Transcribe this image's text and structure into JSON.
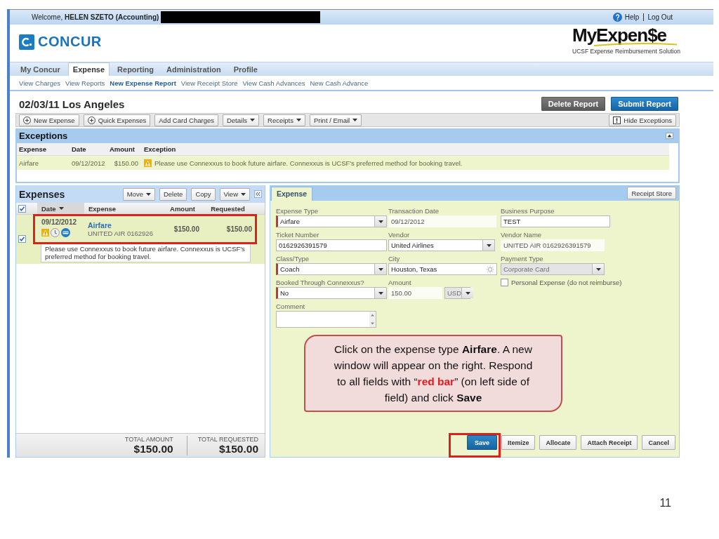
{
  "header": {
    "welcome": "Welcome, **HELEN SZETO (Accounting)**",
    "links": [
      "Help",
      "Log Out"
    ]
  },
  "logo": {
    "name": "CONCUR"
  },
  "brand": {
    "title": "MyExpen$e",
    "subtitle": "UCSF Expense Reimbursement Solution"
  },
  "nav": {
    "tabs": [
      {
        "label": "My Concur",
        "selected": false
      },
      {
        "label": "Expense",
        "selected": true
      },
      {
        "label": "Reporting",
        "selected": false
      },
      {
        "label": "Administration",
        "selected": false
      },
      {
        "label": "Profile",
        "selected": false
      }
    ]
  },
  "subnav": [
    {
      "label": "View Charges",
      "selected": false
    },
    {
      "label": "View Reports",
      "selected": false
    },
    {
      "label": "New Expense Report",
      "selected": true
    },
    {
      "label": "View Receipt Store",
      "selected": false
    },
    {
      "label": "View Cash Advances",
      "selected": false
    },
    {
      "label": "New Cash Advance",
      "selected": false
    }
  ],
  "report": {
    "title": "02/03/11 Los Angeles",
    "actions": [
      {
        "label": "Delete Report",
        "kind": "secondary"
      },
      {
        "label": "Submit Report",
        "kind": "primary"
      }
    ]
  },
  "toolbar": {
    "buttons": [
      {
        "label": "New Expense",
        "kind": "add"
      },
      {
        "label": "Quick Expenses",
        "kind": "add"
      },
      {
        "label": "Add Card Charges",
        "kind": "plain"
      },
      {
        "label": "Details",
        "kind": "menu"
      },
      {
        "label": "Receipts",
        "kind": "menu"
      },
      {
        "label": "Print / Email",
        "kind": "menu"
      }
    ],
    "toggle": {
      "label": "Hide Exceptions"
    }
  },
  "exceptions": {
    "title": "Exceptions",
    "columns": [
      "Expense",
      "Date",
      "Amount",
      "Exception"
    ],
    "rows": [
      {
        "expense": "Airfare",
        "date": "09/12/2012",
        "amount": "$150.00",
        "exception": "Please use Connexxus to book future airfare. Connexxus is UCSF's preferred method for booking travel."
      }
    ]
  },
  "expenses": {
    "title": "Expenses",
    "buttons": [
      {
        "label": "Move",
        "kind": "menu"
      },
      {
        "label": "Delete",
        "kind": "plain"
      },
      {
        "label": "Copy",
        "kind": "plain"
      },
      {
        "label": "View",
        "kind": "menu"
      }
    ],
    "all_checked": true,
    "columns": [
      {
        "label": "Date",
        "sorted": true
      },
      {
        "label": "Expense",
        "sorted": false
      },
      {
        "label": "Amount",
        "sorted": false
      },
      {
        "label": "Requested",
        "sorted": false
      }
    ],
    "rows": [
      {
        "checked": true,
        "selected": true,
        "highlighted": true,
        "date": "09/12/2012",
        "type": "Airfare",
        "vendor": "UNITED AIR 0162926",
        "amount": "$150.00",
        "requested": "$150.00",
        "note": "Please use Connexxus to book future airfare. Connexxus is UCSF's preferred method for booking travel."
      }
    ],
    "totals": [
      {
        "label": "TOTAL AMOUNT",
        "value": "$150.00"
      },
      {
        "label": "TOTAL REQUESTED",
        "value": "$150.00"
      }
    ]
  },
  "form": {
    "tabs": [
      {
        "label": "Expense",
        "selected": true
      }
    ],
    "side_button": "Receipt Store",
    "columns": [
      {
        "fields": [
          {
            "label": "Expense Type",
            "kind": "select",
            "value": "Airfare",
            "required": true,
            "disabled": false
          },
          {
            "label": "Ticket Number",
            "kind": "text",
            "value": "0162926391579",
            "required": false,
            "disabled": false
          },
          {
            "label": "Class/Type",
            "kind": "select",
            "value": "Coach",
            "required": true,
            "disabled": false
          },
          {
            "label": "Booked Through Connexxus?",
            "kind": "select",
            "value": "No",
            "required": true,
            "disabled": false
          },
          {
            "label": "Comment",
            "kind": "textarea",
            "required": false,
            "disabled": false
          }
        ]
      },
      {
        "fields": [
          {
            "label": "Transaction Date",
            "kind": "readonly",
            "value": "09/12/2012",
            "required": false,
            "disabled": false
          },
          {
            "label": "Vendor",
            "kind": "select",
            "value": "United Airlines",
            "required": false,
            "disabled": false
          },
          {
            "label": "City",
            "kind": "lookup",
            "value": "Houston, Texas",
            "required": false,
            "disabled": false
          },
          {
            "label": "Amount",
            "kind": "amount",
            "value": "150.00",
            "required": false,
            "disabled": false,
            "currency": {
              "value": "USD",
              "disabled": true
            }
          }
        ]
      },
      {
        "fields": [
          {
            "label": "Business Purpose",
            "kind": "text",
            "value": "TEST",
            "required": false,
            "disabled": false
          },
          {
            "label": "Vendor Name",
            "kind": "readonly",
            "value": "UNITED AIR 0162926391579",
            "required": false,
            "disabled": false
          },
          {
            "label": "Payment Type",
            "kind": "select",
            "value": "Corporate Card",
            "required": false,
            "disabled": true
          },
          {
            "label": "Personal Expense (do not reimburse)",
            "kind": "checkbox",
            "checked": false
          }
        ]
      }
    ],
    "buttons": [
      {
        "label": "Save",
        "kind": "primary",
        "highlighted": true
      },
      {
        "label": "Itemize",
        "kind": "plain",
        "highlighted": false
      },
      {
        "label": "Allocate",
        "kind": "plain",
        "highlighted": false
      },
      {
        "label": "Attach Receipt",
        "kind": "plain",
        "highlighted": false
      },
      {
        "label": "Cancel",
        "kind": "plain",
        "highlighted": false
      }
    ]
  },
  "callout": {
    "parts": [
      {
        "text": "Click on the expense type ",
        "kind": "plain"
      },
      {
        "text": "Airfare",
        "kind": "bold"
      },
      {
        "text": ". A new window will appear on the right. Respond to all fields with “",
        "kind": "plain"
      },
      {
        "text": "red bar",
        "kind": "alert"
      },
      {
        "text": "” (on left side of field) and click ",
        "kind": "plain"
      },
      {
        "text": "Save",
        "kind": "bold"
      }
    ]
  },
  "slide_number": "11"
}
